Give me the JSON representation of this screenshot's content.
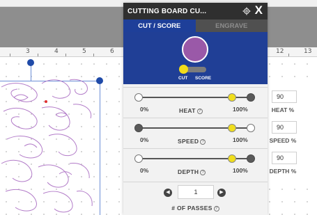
{
  "panel": {
    "title": "CUTTING BOARD CU...",
    "close_label": "X",
    "gear_icon": "gear-icon",
    "tabs": [
      {
        "label": "CUT / SCORE",
        "active": true
      },
      {
        "label": "ENGRAVE",
        "active": false
      }
    ],
    "preview": {
      "swatch_color": "#9a59a8",
      "cut_label": "CUT",
      "score_label": "SCORE"
    },
    "sliders": [
      {
        "name": "heat",
        "min_label": "0%",
        "max_label": "100%",
        "label": "HEAT",
        "value": "90",
        "value_label": "HEAT %",
        "level": 0.9
      },
      {
        "name": "speed",
        "min_label": "0%",
        "max_label": "100%",
        "label": "SPEED",
        "value": "90",
        "value_label": "SPEED %",
        "level": 0.9
      },
      {
        "name": "depth",
        "min_label": "0%",
        "max_label": "100%",
        "label": "DEPTH",
        "value": "90",
        "value_label": "DEPTH %",
        "level": 0.9
      }
    ],
    "passes": {
      "value": "1",
      "label": "# OF PASSES"
    }
  },
  "ruler": {
    "numbers": [
      "3",
      "4",
      "5",
      "6",
      "12",
      "13"
    ]
  },
  "colors": {
    "accent_blue": "#1e3f99",
    "knob_yellow": "#f0de1c",
    "floral_purple": "#b27bc8"
  }
}
